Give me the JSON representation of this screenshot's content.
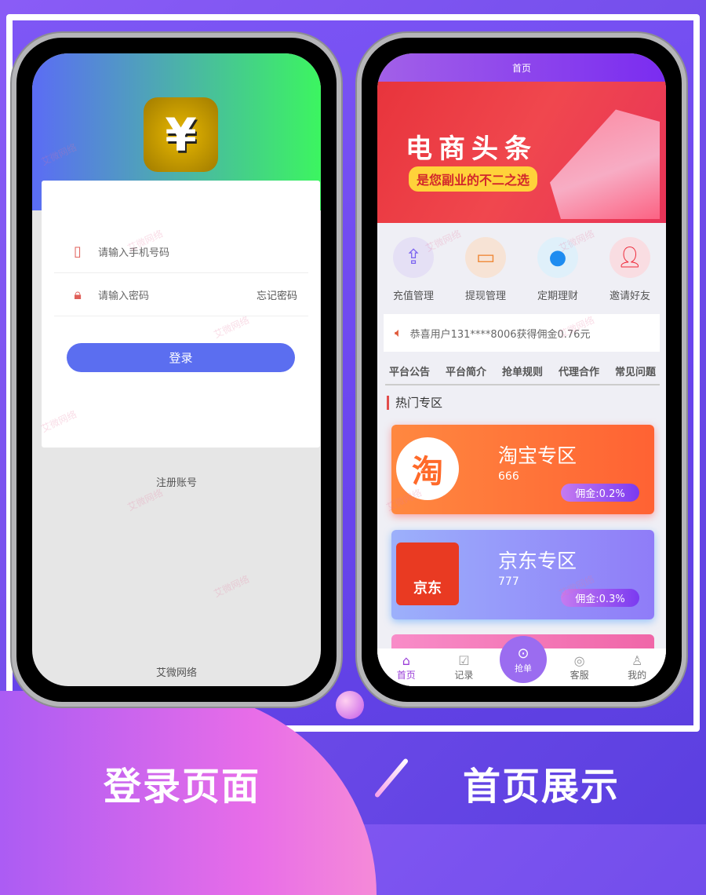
{
  "watermark": "艾微网络",
  "login": {
    "phone_placeholder": "请输入手机号码",
    "password_placeholder": "请输入密码",
    "forgot": "忘记密码",
    "login_button": "登录",
    "register": "注册账号",
    "footer": "艾微网络",
    "logo_glyph": "¥",
    "colors": {
      "header_from": "#5b6cf5",
      "header_to": "#3cf560",
      "button": "#5b6ef0"
    }
  },
  "home": {
    "title": "首页",
    "banner": {
      "title": "电商头条",
      "subtitle": "是您副业的不二之选"
    },
    "shortcuts": [
      {
        "label": "充值管理",
        "icon": "upload-card-icon"
      },
      {
        "label": "提现管理",
        "icon": "card-icon"
      },
      {
        "label": "定期理财",
        "icon": "piggy-bank-icon"
      },
      {
        "label": "邀请好友",
        "icon": "users-icon"
      }
    ],
    "notice": "恭喜用户131****8006获得佣金0.76元",
    "tabs": [
      "平台公告",
      "平台简介",
      "抢单规则",
      "代理合作",
      "常见问题"
    ],
    "section": "热门专区",
    "zones": [
      {
        "name": "淘宝专区",
        "count": "666",
        "commission": "佣金:0.2%",
        "logo": "淘"
      },
      {
        "name": "京东专区",
        "count": "777",
        "commission": "佣金:0.3%",
        "logo": "京东"
      }
    ],
    "tabbar": [
      {
        "label": "首页",
        "icon": "home-icon"
      },
      {
        "label": "记录",
        "icon": "clipboard-icon"
      },
      {
        "label": "抢单",
        "icon": "grab-icon"
      },
      {
        "label": "客服",
        "icon": "headset-icon"
      },
      {
        "label": "我的",
        "icon": "user-icon"
      }
    ]
  },
  "captions": {
    "left": "登录页面",
    "right": "首页展示"
  }
}
